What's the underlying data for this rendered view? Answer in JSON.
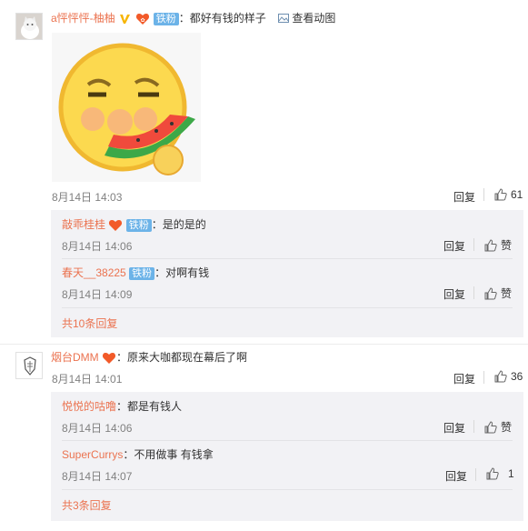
{
  "comments": [
    {
      "user": "a怦怦怦-柚柚",
      "verified_mark": "V",
      "fan_badge": "铁粉",
      "text": "都好有钱的样子",
      "view_gif_label": "查看动图",
      "time": "8月14日 14:03",
      "reply_label": "回复",
      "like_count": "61",
      "replies": [
        {
          "user": "敲乖桂桂",
          "fan_badge": "铁粉",
          "text": "是的是的",
          "time": "8月14日 14:06",
          "reply_label": "回复",
          "like_label": "赞"
        },
        {
          "user": "春天__38225",
          "fan_badge": "铁粉",
          "text": "对啊有钱",
          "time": "8月14日 14:09",
          "reply_label": "回复",
          "like_label": "赞"
        }
      ],
      "more_replies": "共10条回复"
    },
    {
      "user": "烟台DMM",
      "text": "原来大咖都现在幕后了啊",
      "time": "8月14日 14:01",
      "reply_label": "回复",
      "like_count": "36",
      "replies": [
        {
          "user": "悦悦的咕噜",
          "text": "都是有钱人",
          "time": "8月14日 14:06",
          "reply_label": "回复",
          "like_label": "赞"
        },
        {
          "user": "SuperCurrys",
          "text": "不用做事 有钱拿",
          "time": "8月14日 14:07",
          "reply_label": "回复",
          "like_label": "1"
        }
      ],
      "more_replies": "共3条回复"
    }
  ],
  "colors": {
    "username": "#eb7350",
    "fan_badge_bg": "#6cb3e8",
    "reply_box_bg": "#f2f2f5",
    "link_blue": "#2c6ea6"
  },
  "icons": [
    "avatar-cat",
    "vip-verified-icon",
    "fan-heart-icon",
    "image-icon",
    "thumb-up-icon",
    "emoji-sticker-watermelon",
    "avatar-dmm-logo"
  ]
}
